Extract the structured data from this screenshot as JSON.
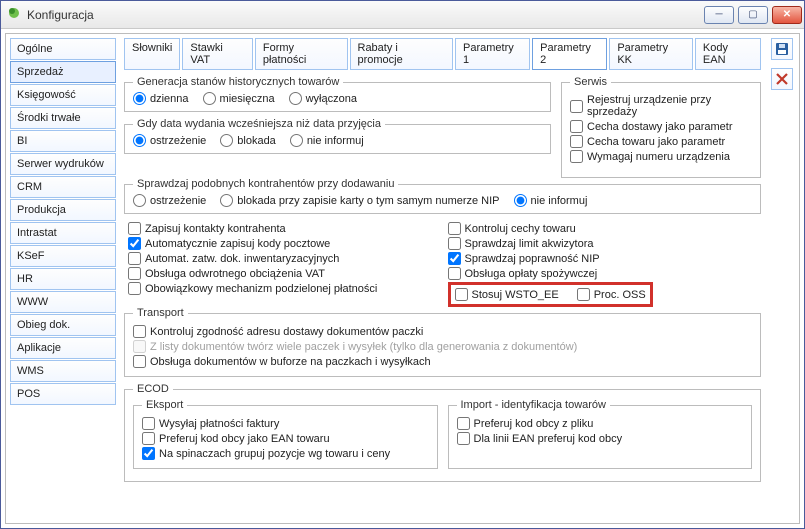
{
  "window": {
    "title": "Konfiguracja"
  },
  "sidebar": {
    "items": [
      "Ogólne",
      "Sprzedaż",
      "Księgowość",
      "Środki trwałe",
      "BI",
      "Serwer wydruków",
      "CRM",
      "Produkcja",
      "Intrastat",
      "KSeF",
      "HR",
      "WWW",
      "Obieg dok.",
      "Aplikacje",
      "WMS",
      "POS"
    ],
    "active_index": 1
  },
  "tabs": {
    "items": [
      "Słowniki",
      "Stawki VAT",
      "Formy płatności",
      "Rabaty i promocje",
      "Parametry 1",
      "Parametry 2",
      "Parametry KK",
      "Kody EAN"
    ],
    "active_index": 5
  },
  "groups": {
    "gen_hist": {
      "legend": "Generacja stanów historycznych towarów",
      "options": {
        "daily": "dzienna",
        "monthly": "miesięczna",
        "off": "wyłączona"
      },
      "selected": "daily"
    },
    "serwis": {
      "legend": "Serwis",
      "checks": {
        "reg": "Rejestruj urządzenie przy sprzedaży",
        "dost": "Cecha dostawy jako parametr",
        "tow": "Cecha towaru jako parametr",
        "num": "Wymagaj numeru urządzenia"
      }
    },
    "data_wyd": {
      "legend": "Gdy data wydania wcześniejsza niż data przyjęcia",
      "options": {
        "warn": "ostrzeżenie",
        "block": "blokada",
        "none": "nie informuj"
      },
      "selected": "warn"
    },
    "kontrahenci": {
      "legend": "Sprawdzaj podobnych kontrahentów przy dodawaniu",
      "options": {
        "warn": "ostrzeżenie",
        "block": "blokada przy zapisie karty o tym samym numerze NIP",
        "none": "nie informuj"
      },
      "selected": "none"
    },
    "left_checks": {
      "c1": "Zapisuj kontakty kontrahenta",
      "c2": "Automatycznie zapisuj kody pocztowe",
      "c3": "Automat. zatw. dok. inwentaryzacyjnych",
      "c4": "Obsługa odwrotnego obciążenia VAT",
      "c5": "Obowiązkowy mechanizm podzielonej płatności"
    },
    "right_checks": {
      "c1": "Kontroluj cechy towaru",
      "c2": "Sprawdzaj limit akwizytora",
      "c3": "Sprawdzaj poprawność NIP",
      "c4": "Obsługa opłaty spożywczej"
    },
    "highlight": {
      "wsto": "Stosuj WSTO_EE",
      "oss": "Proc. OSS"
    },
    "transport": {
      "legend": "Transport",
      "c1": "Kontroluj zgodność adresu dostawy dokumentów paczki",
      "c2": "Z listy dokumentów twórz wiele paczek i wysyłek (tylko dla generowania z dokumentów)",
      "c3": "Obsługa dokumentów w buforze na paczkach i wysyłkach"
    },
    "ecod": {
      "legend": "ECOD",
      "eksport": {
        "legend": "Eksport",
        "c1": "Wysyłaj płatności faktury",
        "c2": "Preferuj kod obcy jako EAN towaru",
        "c3": "Na spinaczach grupuj pozycje wg towaru i ceny"
      },
      "import": {
        "legend": "Import - identyfikacja towarów",
        "c1": "Preferuj kod obcy z pliku",
        "c2": "Dla linii EAN preferuj kod obcy"
      }
    }
  }
}
